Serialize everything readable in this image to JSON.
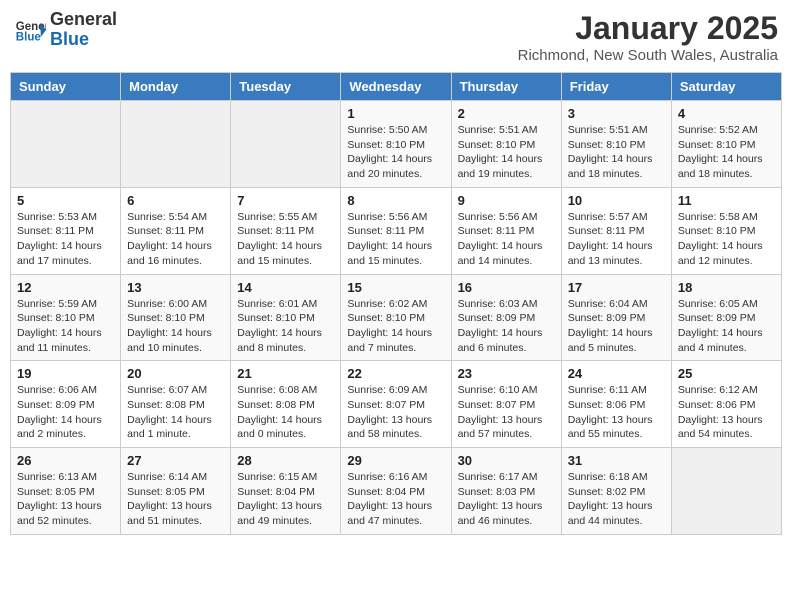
{
  "header": {
    "logo_general": "General",
    "logo_blue": "Blue",
    "month_title": "January 2025",
    "location": "Richmond, New South Wales, Australia"
  },
  "weekdays": [
    "Sunday",
    "Monday",
    "Tuesday",
    "Wednesday",
    "Thursday",
    "Friday",
    "Saturday"
  ],
  "weeks": [
    [
      {
        "day": "",
        "info": ""
      },
      {
        "day": "",
        "info": ""
      },
      {
        "day": "",
        "info": ""
      },
      {
        "day": "1",
        "info": "Sunrise: 5:50 AM\nSunset: 8:10 PM\nDaylight: 14 hours\nand 20 minutes."
      },
      {
        "day": "2",
        "info": "Sunrise: 5:51 AM\nSunset: 8:10 PM\nDaylight: 14 hours\nand 19 minutes."
      },
      {
        "day": "3",
        "info": "Sunrise: 5:51 AM\nSunset: 8:10 PM\nDaylight: 14 hours\nand 18 minutes."
      },
      {
        "day": "4",
        "info": "Sunrise: 5:52 AM\nSunset: 8:10 PM\nDaylight: 14 hours\nand 18 minutes."
      }
    ],
    [
      {
        "day": "5",
        "info": "Sunrise: 5:53 AM\nSunset: 8:11 PM\nDaylight: 14 hours\nand 17 minutes."
      },
      {
        "day": "6",
        "info": "Sunrise: 5:54 AM\nSunset: 8:11 PM\nDaylight: 14 hours\nand 16 minutes."
      },
      {
        "day": "7",
        "info": "Sunrise: 5:55 AM\nSunset: 8:11 PM\nDaylight: 14 hours\nand 15 minutes."
      },
      {
        "day": "8",
        "info": "Sunrise: 5:56 AM\nSunset: 8:11 PM\nDaylight: 14 hours\nand 15 minutes."
      },
      {
        "day": "9",
        "info": "Sunrise: 5:56 AM\nSunset: 8:11 PM\nDaylight: 14 hours\nand 14 minutes."
      },
      {
        "day": "10",
        "info": "Sunrise: 5:57 AM\nSunset: 8:11 PM\nDaylight: 14 hours\nand 13 minutes."
      },
      {
        "day": "11",
        "info": "Sunrise: 5:58 AM\nSunset: 8:10 PM\nDaylight: 14 hours\nand 12 minutes."
      }
    ],
    [
      {
        "day": "12",
        "info": "Sunrise: 5:59 AM\nSunset: 8:10 PM\nDaylight: 14 hours\nand 11 minutes."
      },
      {
        "day": "13",
        "info": "Sunrise: 6:00 AM\nSunset: 8:10 PM\nDaylight: 14 hours\nand 10 minutes."
      },
      {
        "day": "14",
        "info": "Sunrise: 6:01 AM\nSunset: 8:10 PM\nDaylight: 14 hours\nand 8 minutes."
      },
      {
        "day": "15",
        "info": "Sunrise: 6:02 AM\nSunset: 8:10 PM\nDaylight: 14 hours\nand 7 minutes."
      },
      {
        "day": "16",
        "info": "Sunrise: 6:03 AM\nSunset: 8:09 PM\nDaylight: 14 hours\nand 6 minutes."
      },
      {
        "day": "17",
        "info": "Sunrise: 6:04 AM\nSunset: 8:09 PM\nDaylight: 14 hours\nand 5 minutes."
      },
      {
        "day": "18",
        "info": "Sunrise: 6:05 AM\nSunset: 8:09 PM\nDaylight: 14 hours\nand 4 minutes."
      }
    ],
    [
      {
        "day": "19",
        "info": "Sunrise: 6:06 AM\nSunset: 8:09 PM\nDaylight: 14 hours\nand 2 minutes."
      },
      {
        "day": "20",
        "info": "Sunrise: 6:07 AM\nSunset: 8:08 PM\nDaylight: 14 hours\nand 1 minute."
      },
      {
        "day": "21",
        "info": "Sunrise: 6:08 AM\nSunset: 8:08 PM\nDaylight: 14 hours\nand 0 minutes."
      },
      {
        "day": "22",
        "info": "Sunrise: 6:09 AM\nSunset: 8:07 PM\nDaylight: 13 hours\nand 58 minutes."
      },
      {
        "day": "23",
        "info": "Sunrise: 6:10 AM\nSunset: 8:07 PM\nDaylight: 13 hours\nand 57 minutes."
      },
      {
        "day": "24",
        "info": "Sunrise: 6:11 AM\nSunset: 8:06 PM\nDaylight: 13 hours\nand 55 minutes."
      },
      {
        "day": "25",
        "info": "Sunrise: 6:12 AM\nSunset: 8:06 PM\nDaylight: 13 hours\nand 54 minutes."
      }
    ],
    [
      {
        "day": "26",
        "info": "Sunrise: 6:13 AM\nSunset: 8:05 PM\nDaylight: 13 hours\nand 52 minutes."
      },
      {
        "day": "27",
        "info": "Sunrise: 6:14 AM\nSunset: 8:05 PM\nDaylight: 13 hours\nand 51 minutes."
      },
      {
        "day": "28",
        "info": "Sunrise: 6:15 AM\nSunset: 8:04 PM\nDaylight: 13 hours\nand 49 minutes."
      },
      {
        "day": "29",
        "info": "Sunrise: 6:16 AM\nSunset: 8:04 PM\nDaylight: 13 hours\nand 47 minutes."
      },
      {
        "day": "30",
        "info": "Sunrise: 6:17 AM\nSunset: 8:03 PM\nDaylight: 13 hours\nand 46 minutes."
      },
      {
        "day": "31",
        "info": "Sunrise: 6:18 AM\nSunset: 8:02 PM\nDaylight: 13 hours\nand 44 minutes."
      },
      {
        "day": "",
        "info": ""
      }
    ]
  ]
}
